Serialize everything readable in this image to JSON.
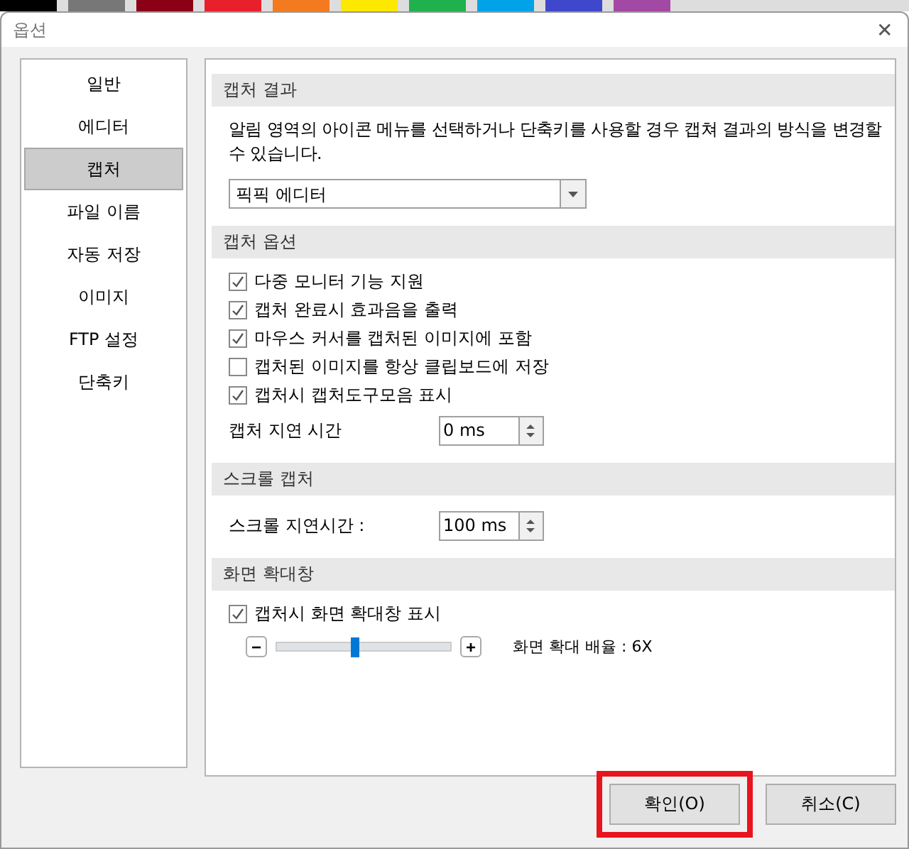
{
  "window": {
    "title": "옵션",
    "close": "✕"
  },
  "sidebar": {
    "items": [
      {
        "label": "일반",
        "selected": false
      },
      {
        "label": "에디터",
        "selected": false
      },
      {
        "label": "캡처",
        "selected": true
      },
      {
        "label": "파일 이름",
        "selected": false
      },
      {
        "label": "자동 저장",
        "selected": false
      },
      {
        "label": "이미지",
        "selected": false
      },
      {
        "label": "FTP 설정",
        "selected": false
      },
      {
        "label": "단축키",
        "selected": false
      }
    ]
  },
  "sections": [
    {
      "title": "캡처 결과",
      "items": [
        {
          "kind": "text",
          "text": "알림 영역의 아이콘 메뉴를 선택하거나 단축키를 사용할 경우 캡쳐 결과의 방식을 변경할 수 있습니다."
        },
        {
          "kind": "dropdown",
          "value": "픽픽 에디터"
        }
      ]
    },
    {
      "title": "캡처 옵션",
      "items": [
        {
          "kind": "checkbox",
          "label": "다중 모니터 기능 지원",
          "checked": true
        },
        {
          "kind": "checkbox",
          "label": "캡처 완료시 효과음을 출력",
          "checked": true
        },
        {
          "kind": "checkbox",
          "label": "마우스 커서를 캡처된 이미지에 포함",
          "checked": true
        },
        {
          "kind": "checkbox",
          "label": "캡처된 이미지를 항상 클립보드에 저장",
          "checked": false
        },
        {
          "kind": "checkbox",
          "label": "캡처시 캡처도구모음 표시",
          "checked": true
        },
        {
          "kind": "spinner",
          "label": "캡처 지연 시간",
          "value": "0 ms"
        }
      ]
    },
    {
      "title": "스크롤 캡처",
      "items": [
        {
          "kind": "spinner",
          "label": "스크롤 지연시간 :",
          "value": "100 ms"
        }
      ]
    },
    {
      "title": "화면 확대창",
      "items": [
        {
          "kind": "checkbox",
          "label": "캡처시 화면 확대창 표시",
          "checked": true
        },
        {
          "kind": "slider",
          "minus": "−",
          "plus": "+",
          "level": 0.45,
          "reading": "화면 확대 배율 : 6X"
        }
      ]
    }
  ],
  "buttons": [
    {
      "label": "확인(O)",
      "highlighted": true
    },
    {
      "label": "취소(C)",
      "highlighted": false
    }
  ]
}
